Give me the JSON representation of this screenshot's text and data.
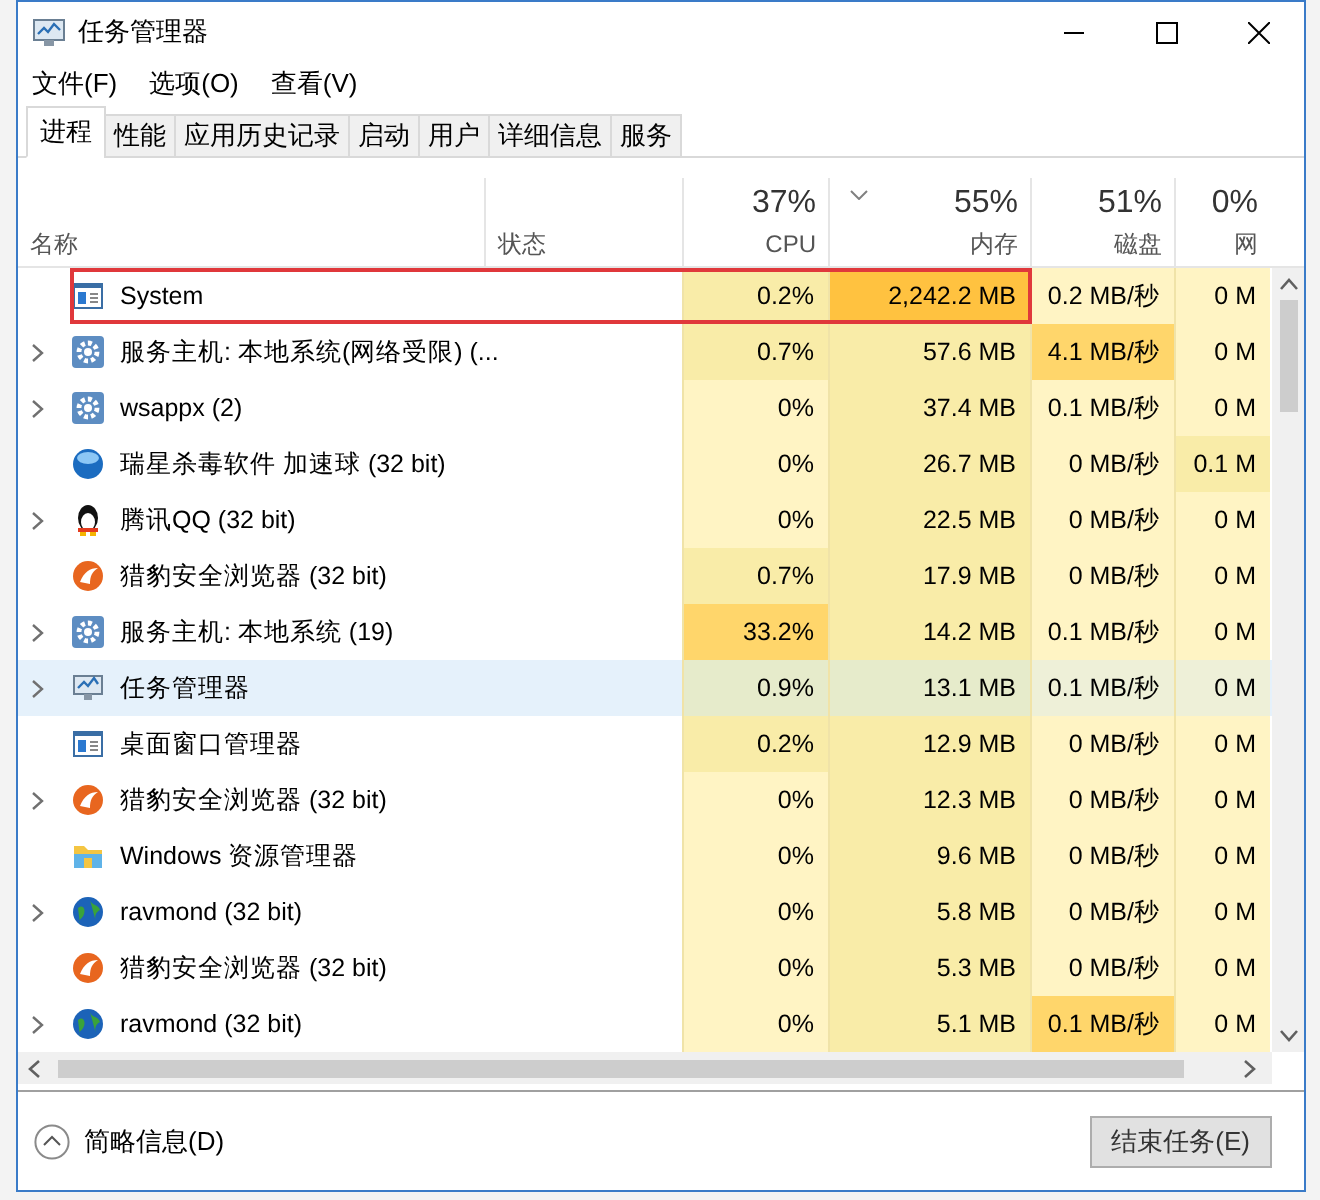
{
  "window": {
    "title": "任务管理器"
  },
  "menu": [
    "文件(F)",
    "选项(O)",
    "查看(V)"
  ],
  "tabs": [
    {
      "label": "进程",
      "selected": true
    },
    {
      "label": "性能",
      "selected": false
    },
    {
      "label": "应用历史记录",
      "selected": false
    },
    {
      "label": "启动",
      "selected": false
    },
    {
      "label": "用户",
      "selected": false
    },
    {
      "label": "详细信息",
      "selected": false
    },
    {
      "label": "服务",
      "selected": false
    }
  ],
  "columns": [
    {
      "label": "名称"
    },
    {
      "label": "状态"
    },
    {
      "label": "CPU",
      "percent": "37%",
      "sorted": false
    },
    {
      "label": "内存",
      "percent": "55%",
      "sorted": true
    },
    {
      "label": "磁盘",
      "percent": "51%",
      "sorted": false
    },
    {
      "label": "网",
      "percent": "0%",
      "sorted": false
    }
  ],
  "rows": [
    {
      "kind": "window",
      "expandable": false,
      "highlighted": true,
      "hovered": false,
      "name": "System",
      "cpu": {
        "text": "0.2%",
        "color": "#f9eca8"
      },
      "memory": {
        "text": "2,242.2 MB",
        "color": "#ffc240"
      },
      "disk": {
        "text": "0.2 MB/秒",
        "color": "#fff4c4"
      },
      "network": {
        "text": "0 M",
        "color": "#fff4c4"
      }
    },
    {
      "kind": "gear",
      "expandable": true,
      "highlighted": false,
      "hovered": false,
      "name": "服务主机: 本地系统(网络受限) (...",
      "cpu": {
        "text": "0.7%",
        "color": "#f9eca8"
      },
      "memory": {
        "text": "57.6 MB",
        "color": "#f9eca8"
      },
      "disk": {
        "text": "4.1 MB/秒",
        "color": "#ffd66b"
      },
      "network": {
        "text": "0 M",
        "color": "#fff4c4"
      }
    },
    {
      "kind": "gear",
      "expandable": true,
      "highlighted": false,
      "hovered": false,
      "name": "wsappx (2)",
      "cpu": {
        "text": "0%",
        "color": "#fff4c4"
      },
      "memory": {
        "text": "37.4 MB",
        "color": "#f9eca8"
      },
      "disk": {
        "text": "0.1 MB/秒",
        "color": "#fff4c4"
      },
      "network": {
        "text": "0 M",
        "color": "#fff4c4"
      }
    },
    {
      "kind": "ball",
      "expandable": false,
      "highlighted": false,
      "hovered": false,
      "name": "瑞星杀毒软件 加速球 (32 bit)",
      "cpu": {
        "text": "0%",
        "color": "#fff4c4"
      },
      "memory": {
        "text": "26.7 MB",
        "color": "#f9eca8"
      },
      "disk": {
        "text": "0 MB/秒",
        "color": "#fff4c4"
      },
      "network": {
        "text": "0.1 M",
        "color": "#f9eca8"
      }
    },
    {
      "kind": "penguin",
      "expandable": true,
      "highlighted": false,
      "hovered": false,
      "name": "腾讯QQ (32 bit)",
      "cpu": {
        "text": "0%",
        "color": "#fff4c4"
      },
      "memory": {
        "text": "22.5 MB",
        "color": "#f9eca8"
      },
      "disk": {
        "text": "0 MB/秒",
        "color": "#fff4c4"
      },
      "network": {
        "text": "0 M",
        "color": "#fff4c4"
      }
    },
    {
      "kind": "fox",
      "expandable": false,
      "highlighted": false,
      "hovered": false,
      "name": "猎豹安全浏览器 (32 bit)",
      "cpu": {
        "text": "0.7%",
        "color": "#f9eca8"
      },
      "memory": {
        "text": "17.9 MB",
        "color": "#f9eca8"
      },
      "disk": {
        "text": "0 MB/秒",
        "color": "#fff4c4"
      },
      "network": {
        "text": "0 M",
        "color": "#fff4c4"
      }
    },
    {
      "kind": "gear",
      "expandable": true,
      "highlighted": false,
      "hovered": false,
      "name": "服务主机: 本地系统 (19)",
      "cpu": {
        "text": "33.2%",
        "color": "#ffd66b"
      },
      "memory": {
        "text": "14.2 MB",
        "color": "#f9eca8"
      },
      "disk": {
        "text": "0.1 MB/秒",
        "color": "#fff4c4"
      },
      "network": {
        "text": "0 M",
        "color": "#fff4c4"
      }
    },
    {
      "kind": "monitor",
      "expandable": true,
      "highlighted": false,
      "hovered": true,
      "name": "任务管理器",
      "cpu": {
        "text": "0.9%",
        "color": "#e6ebcb"
      },
      "memory": {
        "text": "13.1 MB",
        "color": "#e6ebcb"
      },
      "disk": {
        "text": "0.1 MB/秒",
        "color": "#eef0d8"
      },
      "network": {
        "text": "0 M",
        "color": "#eef0d8"
      }
    },
    {
      "kind": "window",
      "expandable": false,
      "highlighted": false,
      "hovered": false,
      "name": "桌面窗口管理器",
      "cpu": {
        "text": "0.2%",
        "color": "#f9eca8"
      },
      "memory": {
        "text": "12.9 MB",
        "color": "#f9eca8"
      },
      "disk": {
        "text": "0 MB/秒",
        "color": "#fff4c4"
      },
      "network": {
        "text": "0 M",
        "color": "#fff4c4"
      }
    },
    {
      "kind": "fox",
      "expandable": true,
      "highlighted": false,
      "hovered": false,
      "name": "猎豹安全浏览器 (32 bit)",
      "cpu": {
        "text": "0%",
        "color": "#fff4c4"
      },
      "memory": {
        "text": "12.3 MB",
        "color": "#f9eca8"
      },
      "disk": {
        "text": "0 MB/秒",
        "color": "#fff4c4"
      },
      "network": {
        "text": "0 M",
        "color": "#fff4c4"
      }
    },
    {
      "kind": "folder",
      "expandable": false,
      "highlighted": false,
      "hovered": false,
      "name": "Windows 资源管理器",
      "cpu": {
        "text": "0%",
        "color": "#fff4c4"
      },
      "memory": {
        "text": "9.6 MB",
        "color": "#f9eca8"
      },
      "disk": {
        "text": "0 MB/秒",
        "color": "#fff4c4"
      },
      "network": {
        "text": "0 M",
        "color": "#fff4c4"
      }
    },
    {
      "kind": "globe",
      "expandable": true,
      "highlighted": false,
      "hovered": false,
      "name": "ravmond (32 bit)",
      "cpu": {
        "text": "0%",
        "color": "#fff4c4"
      },
      "memory": {
        "text": "5.8 MB",
        "color": "#f9eca8"
      },
      "disk": {
        "text": "0 MB/秒",
        "color": "#fff4c4"
      },
      "network": {
        "text": "0 M",
        "color": "#fff4c4"
      }
    },
    {
      "kind": "fox",
      "expandable": false,
      "highlighted": false,
      "hovered": false,
      "name": "猎豹安全浏览器 (32 bit)",
      "cpu": {
        "text": "0%",
        "color": "#fff4c4"
      },
      "memory": {
        "text": "5.3 MB",
        "color": "#f9eca8"
      },
      "disk": {
        "text": "0 MB/秒",
        "color": "#fff4c4"
      },
      "network": {
        "text": "0 M",
        "color": "#fff4c4"
      }
    },
    {
      "kind": "globe",
      "expandable": true,
      "highlighted": false,
      "hovered": false,
      "name": "ravmond (32 bit)",
      "cpu": {
        "text": "0%",
        "color": "#fff4c4"
      },
      "memory": {
        "text": "5.1 MB",
        "color": "#f9eca8"
      },
      "disk": {
        "text": "0.1 MB/秒",
        "color": "#ffd66b"
      },
      "network": {
        "text": "0 M",
        "color": "#fff4c4"
      }
    }
  ],
  "footer": {
    "details_toggle": "简略信息(D)",
    "end_task_button": "结束任务(E)"
  }
}
